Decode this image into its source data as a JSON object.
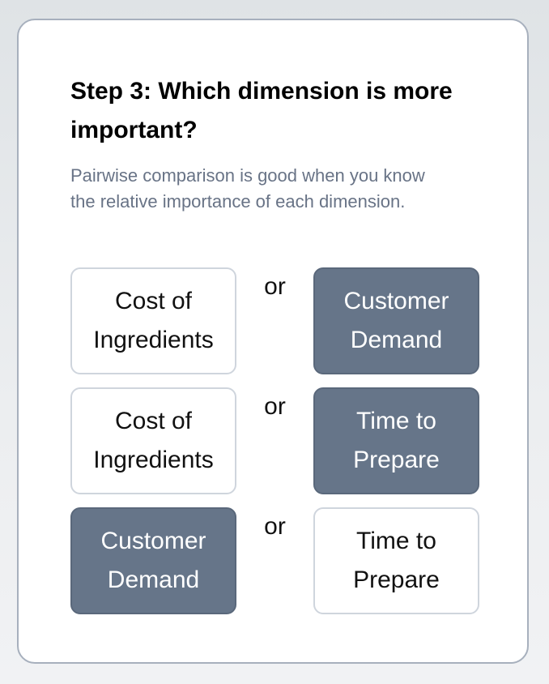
{
  "step": {
    "title": "Step 3: Which dimension is more important?",
    "description": "Pairwise comparison is good when you know the relative importance of each dimension."
  },
  "colors": {
    "selected_background": "#667589",
    "selected_text": "#ffffff",
    "unselected_background": "#ffffff",
    "unselected_border": "#cfd5dd",
    "description_text": "#687386",
    "card_border": "#a7b0bd"
  },
  "pairs": [
    {
      "left": {
        "label": "Cost of Ingredients",
        "selected": false
      },
      "separator": "or",
      "right": {
        "label": "Customer Demand",
        "selected": true
      }
    },
    {
      "left": {
        "label": "Cost of Ingredients",
        "selected": false
      },
      "separator": "or",
      "right": {
        "label": "Time to Prepare",
        "selected": true
      }
    },
    {
      "left": {
        "label": "Customer Demand",
        "selected": true
      },
      "separator": "or",
      "right": {
        "label": "Time to Prepare",
        "selected": false
      }
    }
  ]
}
